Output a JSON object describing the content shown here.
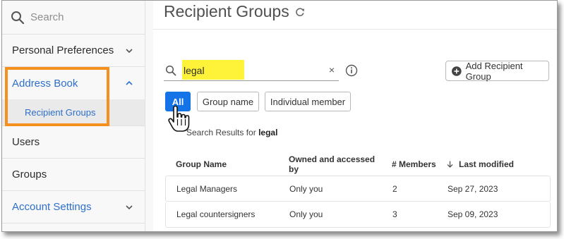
{
  "sidebar": {
    "search_placeholder": "Search",
    "items": [
      {
        "label": "Personal Preferences"
      },
      {
        "label": "Address Book"
      },
      {
        "label": "Recipient Groups"
      },
      {
        "label": "Users"
      },
      {
        "label": "Groups"
      },
      {
        "label": "Account Settings"
      }
    ]
  },
  "main": {
    "title": "Recipient Groups",
    "search_value": "legal",
    "clear_symbol": "×",
    "add_button": "Add Recipient Group",
    "filters": [
      "All",
      "Group name",
      "Individual member"
    ],
    "results_prefix": "Search Results for",
    "results_term": "legal",
    "table": {
      "headers": [
        "Group Name",
        "Owned and accessed by",
        "# Members",
        "Last modified"
      ],
      "rows": [
        [
          "Legal Managers",
          "Only you",
          "2",
          "Sep 27, 2023"
        ],
        [
          "Legal countersigners",
          "Only you",
          "3",
          "Sep 09, 2023"
        ]
      ]
    }
  },
  "colors": {
    "accent": "#1473e6",
    "link": "#2d6fcb",
    "highlight_box": "#f5901e",
    "search_highlight": "#fff33a"
  },
  "icons": [
    "search-icon",
    "chevron-down-icon",
    "chevron-up-icon",
    "refresh-icon",
    "info-icon",
    "plus-circle-icon",
    "hand-pointer-icon",
    "sort-down-icon"
  ]
}
